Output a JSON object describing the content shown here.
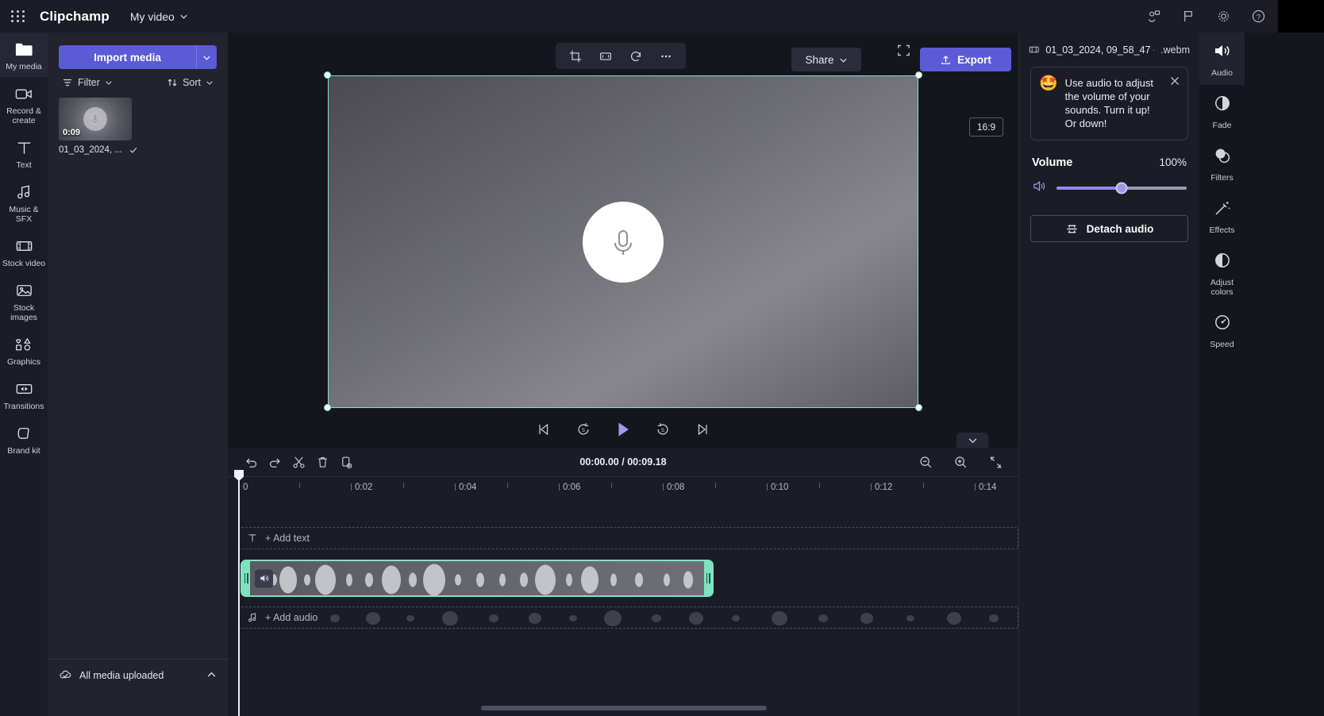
{
  "header": {
    "waffle_icon": "app-launcher-icon",
    "brand": "Clipchamp",
    "project_name": "My video",
    "icons": [
      {
        "name": "share-people-icon",
        "glyph": "share"
      },
      {
        "name": "flag-feedback-icon",
        "glyph": "flag"
      },
      {
        "name": "gear-settings-icon",
        "glyph": "gear"
      },
      {
        "name": "help-icon",
        "glyph": "?"
      }
    ]
  },
  "left_rail": {
    "items": [
      {
        "label": "My media",
        "icon": "folder-icon",
        "active": true
      },
      {
        "label": "Record & create",
        "icon": "video-camera-icon",
        "active": false
      },
      {
        "label": "Text",
        "icon": "text-icon",
        "active": false
      },
      {
        "label": "Music & SFX",
        "icon": "music-note-icon",
        "active": false
      },
      {
        "label": "Stock video",
        "icon": "film-strip-icon",
        "active": false
      },
      {
        "label": "Stock images",
        "icon": "image-icon",
        "active": false
      },
      {
        "label": "Graphics",
        "icon": "shapes-icon",
        "active": false
      },
      {
        "label": "Transitions",
        "icon": "transitions-icon",
        "active": false
      },
      {
        "label": "Brand kit",
        "icon": "brand-kit-icon",
        "active": false
      }
    ]
  },
  "media_panel": {
    "import_label": "Import media",
    "import_caret": "chevron-down-icon",
    "filter_label": "Filter",
    "sort_label": "Sort",
    "item": {
      "duration": "0:09",
      "name": "01_03_2024, ...",
      "check": "checkmark-icon",
      "thumb_icon": "microphone-icon"
    },
    "footer_label": "All media uploaded",
    "footer_icon": "cloud-check-icon",
    "footer_chevron": "chevron-up-icon"
  },
  "preview": {
    "toolbar": [
      {
        "name": "crop-icon",
        "label": "Crop"
      },
      {
        "name": "fit-icon",
        "label": "Fit"
      },
      {
        "name": "rotate-icon",
        "label": "Rotate"
      },
      {
        "name": "more-options-icon",
        "label": "More"
      }
    ],
    "share_label": "Share",
    "export_label": "Export",
    "aspect_ratio": "16:9",
    "canvas_icon": "microphone-icon",
    "transport": [
      {
        "name": "skip-to-start-button",
        "glyph": "start"
      },
      {
        "name": "rewind-5s-button",
        "glyph": "back5"
      },
      {
        "name": "play-button",
        "glyph": "play"
      },
      {
        "name": "forward-5s-button",
        "glyph": "fwd5"
      },
      {
        "name": "skip-to-end-button",
        "glyph": "end"
      }
    ],
    "fullscreen_icon": "fullscreen-icon"
  },
  "right_panel": {
    "clip_name": "01_03_2024, 09_58_47 - ...",
    "clip_ext": ".webm",
    "clip_icon": "film-clip-icon",
    "tip_emoji": "🤩",
    "tip_text": "Use audio to adjust the volume of your sounds. Turn it up! Or down!",
    "tip_close": "close-icon",
    "volume_label": "Volume",
    "volume_value": "100%",
    "volume_icon": "speaker-icon",
    "detach_label": "Detach audio",
    "detach_icon": "detach-audio-icon"
  },
  "right_rail": {
    "items": [
      {
        "label": "Audio",
        "icon": "speaker-icon",
        "active": true
      },
      {
        "label": "Fade",
        "icon": "fade-icon",
        "active": false
      },
      {
        "label": "Filters",
        "icon": "filters-icon",
        "active": false
      },
      {
        "label": "Effects",
        "icon": "effects-wand-icon",
        "active": false
      },
      {
        "label": "Adjust colors",
        "icon": "adjust-colors-icon",
        "active": false
      },
      {
        "label": "Speed",
        "icon": "speed-gauge-icon",
        "active": false
      }
    ]
  },
  "timeline": {
    "tools": [
      {
        "name": "undo-button",
        "icon": "undo-icon"
      },
      {
        "name": "redo-button",
        "icon": "redo-icon"
      },
      {
        "name": "split-button",
        "icon": "scissors-icon"
      },
      {
        "name": "delete-button",
        "icon": "trash-icon"
      },
      {
        "name": "duplicate-button",
        "icon": "duplicate-icon"
      }
    ],
    "current_time": "00:00.00",
    "separator": "/",
    "total_time": "00:09.18",
    "zoom_tools": [
      {
        "name": "zoom-out-button",
        "icon": "zoom-out-icon"
      },
      {
        "name": "zoom-in-button",
        "icon": "zoom-in-icon"
      },
      {
        "name": "fit-timeline-button",
        "icon": "fit-timeline-icon"
      }
    ],
    "ruler_ticks": [
      "0",
      "0:02",
      "0:04",
      "0:06",
      "0:08",
      "0:10",
      "0:12",
      "0:14"
    ],
    "add_text_label": "+ Add text",
    "add_text_icon": "text-icon",
    "add_audio_label": "+ Add audio",
    "add_audio_icon": "music-note-icon",
    "clip_speaker_icon": "speaker-icon",
    "collapse_icon": "chevron-down-icon"
  }
}
